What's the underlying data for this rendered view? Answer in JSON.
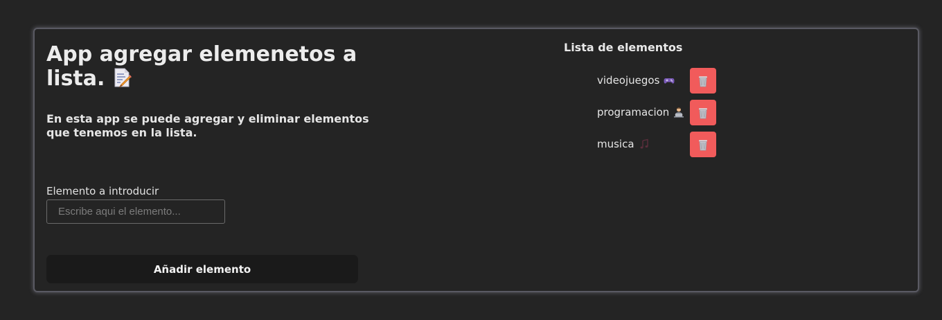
{
  "app": {
    "title": "App agregar elemenetos a lista.",
    "title_icon": "memo-icon",
    "description": "En esta app se puede agregar y eliminar elementos que tenemos en la lista."
  },
  "form": {
    "label": "Elemento a introducir",
    "placeholder": "Escribe aqui el elemento...",
    "value": "",
    "button_label": "Añadir elemento"
  },
  "list": {
    "title": "Lista de elementos",
    "items": [
      {
        "label": "videojuegos",
        "icon": "game-controller-icon"
      },
      {
        "label": "programacion",
        "icon": "technologist-icon"
      },
      {
        "label": "musica",
        "icon": "musical-notes-icon"
      }
    ],
    "delete_icon": "wastebasket-icon"
  },
  "colors": {
    "background": "#242424",
    "card_border": "#5a5a63",
    "button_background": "#1a1a1a",
    "delete_button": "#f15b5b"
  }
}
